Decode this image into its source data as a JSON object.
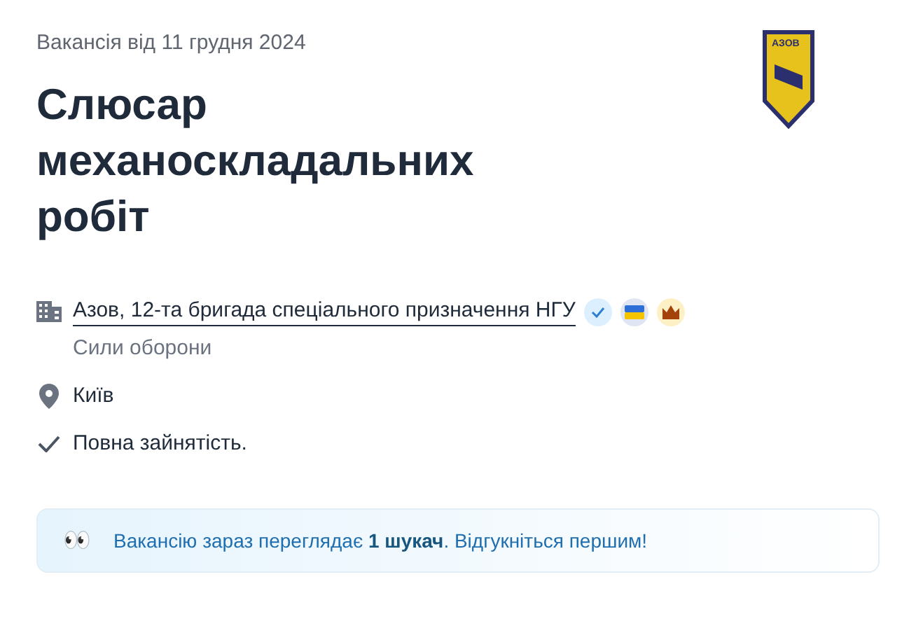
{
  "date": "Вакансія від 11 грудня 2024",
  "title": "Слюсар механоскладальних робіт",
  "logo": {
    "text": "АЗОВ"
  },
  "company": {
    "name": "Азов, 12-та бригада спеціального призначення НГУ",
    "category": "Сили оборони",
    "verified": true,
    "badges": [
      {
        "kind": "flag"
      },
      {
        "kind": "crown"
      }
    ]
  },
  "location": "Київ",
  "employment": "Повна зайнятість.",
  "banner": {
    "icon": "👀",
    "text": "Вакансію зараз переглядає **1 шукач**. Відгукніться першим!"
  }
}
